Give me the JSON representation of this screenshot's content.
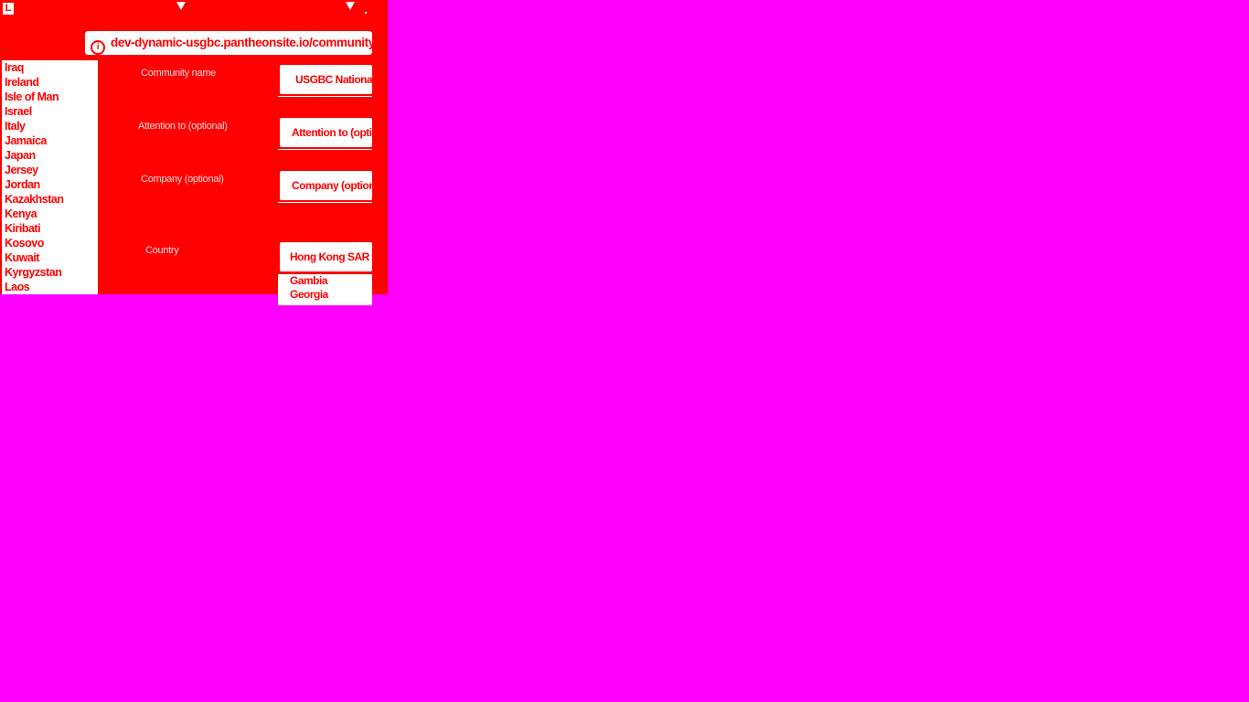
{
  "browser": {
    "url": "dev-dynamic-usgbc.pantheonsite.io/community"
  },
  "country_list": [
    "Iraq",
    "Ireland",
    "Isle of Man",
    "Israel",
    "Italy",
    "Jamaica",
    "Japan",
    "Jersey",
    "Jordan",
    "Kazakhstan",
    "Kenya",
    "Kiribati",
    "Kosovo",
    "Kuwait",
    "Kyrgyzstan",
    "Laos"
  ],
  "form": {
    "community_label": "Community name",
    "community_value": "USGBC National",
    "attention_label": "Attention to (optional)",
    "attention_placeholder": "Attention to (optional)",
    "company_label": "Company (optional)",
    "company_placeholder": "Company (optional)",
    "country_label": "Country",
    "country_value": "Hong Kong SAR",
    "country_options": [
      "Gambia",
      "Georgia"
    ]
  }
}
